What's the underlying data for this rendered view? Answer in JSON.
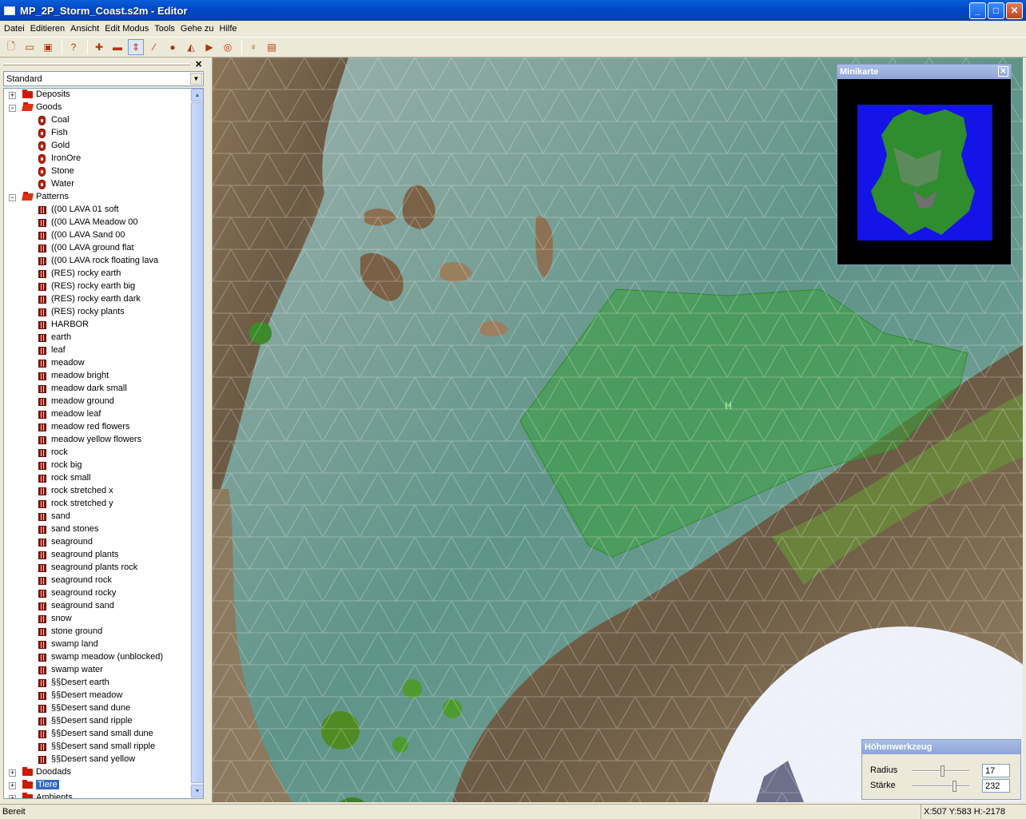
{
  "window": {
    "title": "MP_2P_Storm_Coast.s2m - Editor"
  },
  "menu": [
    "Datei",
    "Editieren",
    "Ansicht",
    "Edit Modus",
    "Tools",
    "Gehe zu",
    "Hilfe"
  ],
  "toolbar": {
    "groups": [
      [
        "new-file-icon",
        "open-folder-icon",
        "save-icon"
      ],
      [
        "help-icon"
      ],
      [
        "raise-icon",
        "lower-icon",
        "height-tool-icon",
        "brush-icon",
        "place-object-icon",
        "fill-icon",
        "play-icon",
        "target-icon"
      ],
      [
        "light-icon",
        "copy-icon"
      ]
    ],
    "active_tool": "height-tool-icon"
  },
  "left_panel": {
    "combo_value": "Standard",
    "tree": [
      {
        "label": "Deposits",
        "type": "folder",
        "expanded": false
      },
      {
        "label": "Goods",
        "type": "folder",
        "expanded": true
      },
      {
        "label": "Coal",
        "type": "good"
      },
      {
        "label": "Fish",
        "type": "good"
      },
      {
        "label": "Gold",
        "type": "good"
      },
      {
        "label": "IronOre",
        "type": "good"
      },
      {
        "label": "Stone",
        "type": "good"
      },
      {
        "label": "Water",
        "type": "good"
      },
      {
        "label": "Patterns",
        "type": "folder",
        "expanded": true
      },
      {
        "label": "((00 LAVA 01 soft",
        "type": "pattern"
      },
      {
        "label": "((00 LAVA Meadow 00",
        "type": "pattern"
      },
      {
        "label": "((00 LAVA Sand 00",
        "type": "pattern"
      },
      {
        "label": "((00 LAVA ground flat",
        "type": "pattern"
      },
      {
        "label": "((00 LAVA rock floating lava",
        "type": "pattern"
      },
      {
        "label": "(RES) rocky earth",
        "type": "pattern"
      },
      {
        "label": "(RES) rocky earth big",
        "type": "pattern"
      },
      {
        "label": "(RES) rocky earth dark",
        "type": "pattern"
      },
      {
        "label": "(RES) rocky plants",
        "type": "pattern"
      },
      {
        "label": "HARBOR",
        "type": "pattern"
      },
      {
        "label": "earth",
        "type": "pattern"
      },
      {
        "label": "leaf",
        "type": "pattern"
      },
      {
        "label": "meadow",
        "type": "pattern"
      },
      {
        "label": "meadow bright",
        "type": "pattern"
      },
      {
        "label": "meadow dark small",
        "type": "pattern"
      },
      {
        "label": "meadow ground",
        "type": "pattern"
      },
      {
        "label": "meadow leaf",
        "type": "pattern"
      },
      {
        "label": "meadow red flowers",
        "type": "pattern"
      },
      {
        "label": "meadow yellow flowers",
        "type": "pattern"
      },
      {
        "label": "rock",
        "type": "pattern"
      },
      {
        "label": "rock big",
        "type": "pattern"
      },
      {
        "label": "rock small",
        "type": "pattern"
      },
      {
        "label": "rock stretched x",
        "type": "pattern"
      },
      {
        "label": "rock stretched y",
        "type": "pattern"
      },
      {
        "label": "sand",
        "type": "pattern"
      },
      {
        "label": "sand stones",
        "type": "pattern"
      },
      {
        "label": "seaground",
        "type": "pattern"
      },
      {
        "label": "seaground plants",
        "type": "pattern"
      },
      {
        "label": "seaground plants rock",
        "type": "pattern"
      },
      {
        "label": "seaground rock",
        "type": "pattern"
      },
      {
        "label": "seaground rocky",
        "type": "pattern"
      },
      {
        "label": "seaground sand",
        "type": "pattern"
      },
      {
        "label": "snow",
        "type": "pattern"
      },
      {
        "label": "stone ground",
        "type": "pattern"
      },
      {
        "label": "swamp land",
        "type": "pattern"
      },
      {
        "label": "swamp meadow (unblocked)",
        "type": "pattern"
      },
      {
        "label": "swamp water",
        "type": "pattern"
      },
      {
        "label": "§§Desert earth",
        "type": "pattern"
      },
      {
        "label": "§§Desert meadow",
        "type": "pattern"
      },
      {
        "label": "§§Desert sand dune",
        "type": "pattern"
      },
      {
        "label": "§§Desert sand ripple",
        "type": "pattern"
      },
      {
        "label": "§§Desert sand small dune",
        "type": "pattern"
      },
      {
        "label": "§§Desert sand small ripple",
        "type": "pattern"
      },
      {
        "label": "§§Desert sand yellow",
        "type": "pattern"
      },
      {
        "label": "Doodads",
        "type": "folder",
        "expanded": false
      },
      {
        "label": "Tiere",
        "type": "folder",
        "expanded": false,
        "selected": true
      },
      {
        "label": "Ambients",
        "type": "folder",
        "expanded": false
      }
    ]
  },
  "minimap": {
    "title": "Minikarte"
  },
  "height_tool": {
    "title": "Höhenwerkzeug",
    "radius_label": "Radius",
    "radius_value": "17",
    "strength_label": "Stärke",
    "strength_value": "232",
    "radius_level": 0.55,
    "strength_level": 0.78
  },
  "status": {
    "left": "Bereit",
    "right": "X:507 Y:583 H:-2178"
  },
  "colors": {
    "title_bar": "#0343b8",
    "selection_overlay": "#3aa03a",
    "water": "#5e8f89",
    "snow": "#eef0fa"
  }
}
